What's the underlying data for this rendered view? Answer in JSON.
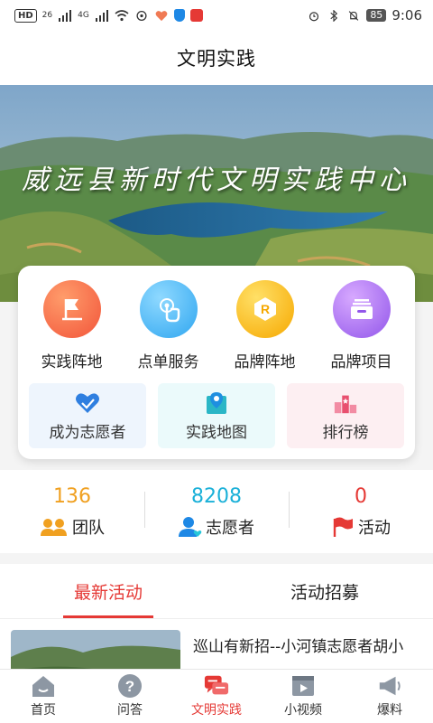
{
  "status_bar": {
    "hd_label": "HD",
    "signal_1": "26",
    "signal_2": "4G",
    "battery": "85",
    "time": "9:06"
  },
  "header": {
    "title": "文明实践"
  },
  "banner": {
    "text": "威远县新时代文明实践中心"
  },
  "functions": [
    {
      "label": "实践阵地",
      "icon": "flag-icon",
      "color": "#f2553a"
    },
    {
      "label": "点单服务",
      "icon": "tap-hand-icon",
      "color": "#2fa6f0"
    },
    {
      "label": "品牌阵地",
      "icon": "brand-r-icon",
      "color": "#f6a800"
    },
    {
      "label": "品牌项目",
      "icon": "archive-box-icon",
      "color": "#9256ea"
    }
  ],
  "quick_links": [
    {
      "label": "成为志愿者",
      "icon": "heart-hands-icon"
    },
    {
      "label": "实践地图",
      "icon": "map-pin-icon"
    },
    {
      "label": "排行榜",
      "icon": "podium-icon"
    }
  ],
  "stats": [
    {
      "value": "136",
      "label": "团队",
      "color": "#f0a020",
      "icon": "team-icon"
    },
    {
      "value": "8208",
      "label": "志愿者",
      "color": "#1ab0d8",
      "icon": "volunteer-icon"
    },
    {
      "value": "0",
      "label": "活动",
      "color": "#e53935",
      "icon": "flag-icon"
    }
  ],
  "tabs": [
    {
      "label": "最新活动",
      "active": true
    },
    {
      "label": "活动招募",
      "active": false
    }
  ],
  "article": {
    "title": "巡山有新招--小河镇志愿者胡小"
  },
  "bottom_nav": [
    {
      "label": "首页",
      "icon": "home-icon",
      "active": false
    },
    {
      "label": "问答",
      "icon": "question-icon",
      "active": false
    },
    {
      "label": "文明实践",
      "icon": "chat-bubbles-icon",
      "active": true
    },
    {
      "label": "小视频",
      "icon": "video-icon",
      "active": false
    },
    {
      "label": "爆料",
      "icon": "megaphone-icon",
      "active": false
    }
  ],
  "colors": {
    "accent": "#e53935",
    "stat_orange": "#f0a020",
    "stat_cyan": "#1ab0d8"
  }
}
